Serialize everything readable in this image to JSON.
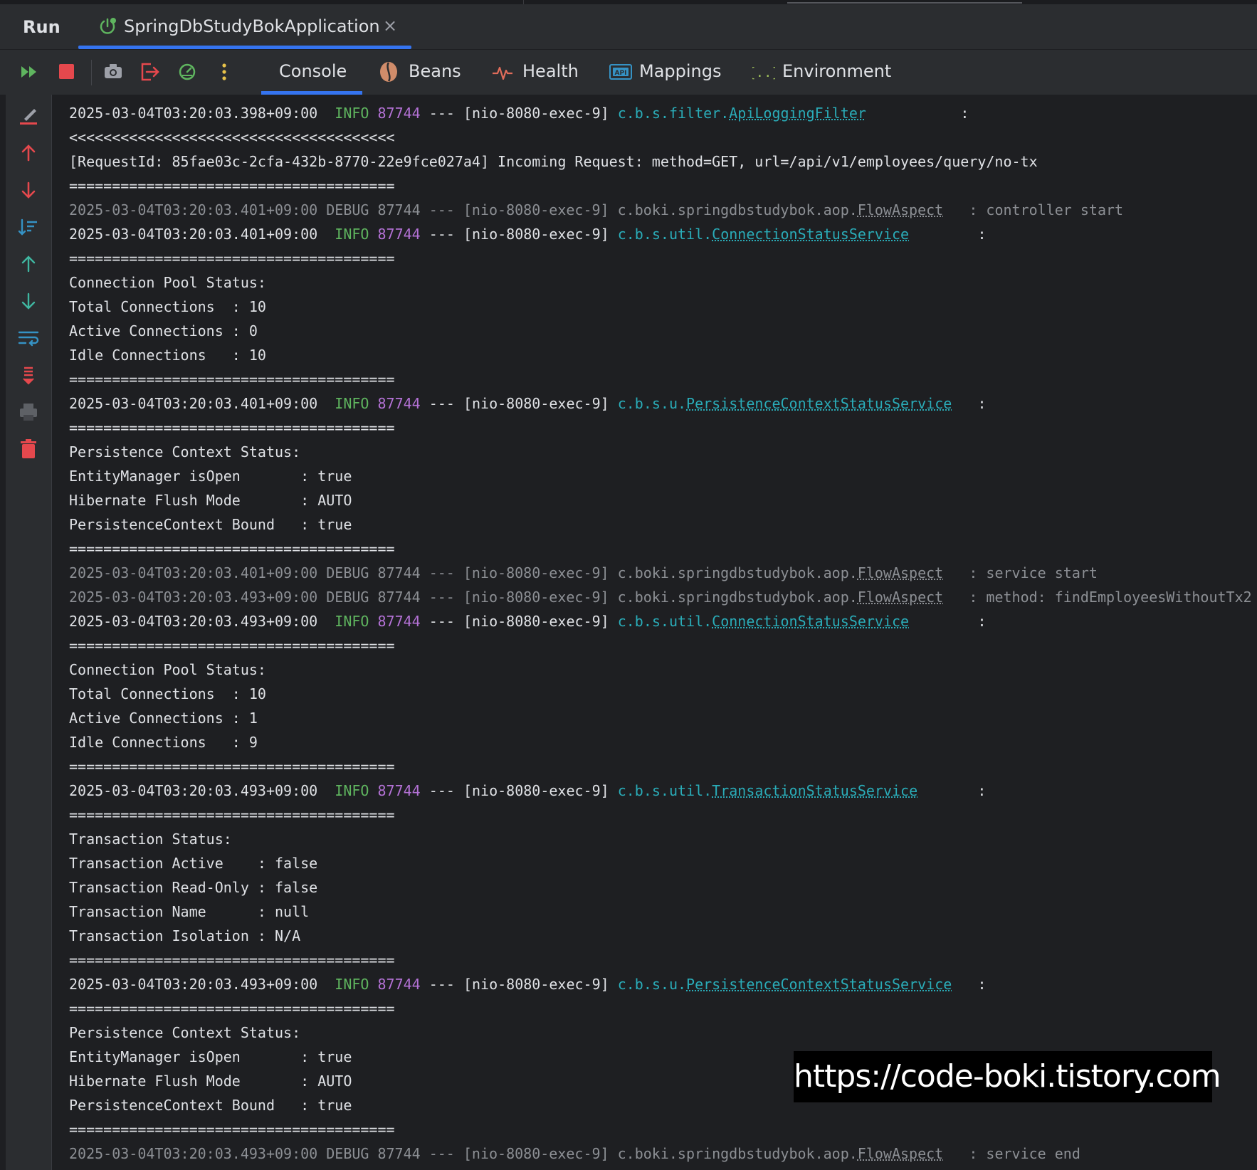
{
  "run_panel": {
    "title": "Run",
    "tab": {
      "label": "SpringDbStudyBokApplication",
      "close": "×"
    }
  },
  "toolbar": {
    "tabs": [
      {
        "label": "Console",
        "icon": "console"
      },
      {
        "label": "Beans",
        "icon": "beans-icon"
      },
      {
        "label": "Health",
        "icon": "health-icon"
      },
      {
        "label": "Mappings",
        "icon": "api-mappings-icon"
      },
      {
        "label": "Environment",
        "icon": "environment-icon"
      }
    ],
    "api_badge": "API",
    "env_badge": "{..}"
  },
  "colors": {
    "accent": "#3574f0",
    "info": "#5fb55f",
    "pid": "#b472d6",
    "logger": "#2aacb8",
    "stop": "#e5484d"
  },
  "console": {
    "lines": [
      {
        "type": "info",
        "ts": "2025-03-04T03:20:03.398+09:00",
        "level": "INFO",
        "pid": "87744",
        "sep": " --- ",
        "thread": "[nio-8080-exec-9] ",
        "pkg": "c.b.s.filter.",
        "cls": "ApiLoggingFilter",
        "pad": "          ",
        "tail": " :"
      },
      {
        "type": "text",
        "text": "<<<<<<<<<<<<<<<<<<<<<<<<<<<<<<<<<<<<<<"
      },
      {
        "type": "text",
        "text": "[RequestId: 85fae03c-2cfa-432b-8770-22e9fce027a4] Incoming Request: method=GET, url=/api/v1/employees/query/no-tx"
      },
      {
        "type": "text",
        "text": "======================================"
      },
      {
        "type": "debug",
        "text": "2025-03-04T03:20:03.401+09:00 DEBUG 87744 --- [nio-8080-exec-9] c.boki.springdbstudybok.aop.",
        "cls": "FlowAspect",
        "tail": "   : controller start"
      },
      {
        "type": "info",
        "ts": "2025-03-04T03:20:03.401+09:00",
        "level": "INFO",
        "pid": "87744",
        "sep": " --- ",
        "thread": "[nio-8080-exec-9] ",
        "pkg": "c.b.s.util.",
        "cls": "ConnectionStatusService",
        "pad": "       ",
        "tail": " :"
      },
      {
        "type": "text",
        "text": "======================================"
      },
      {
        "type": "text",
        "text": "Connection Pool Status:"
      },
      {
        "type": "text",
        "text": "Total Connections  : 10"
      },
      {
        "type": "text",
        "text": "Active Connections : 0"
      },
      {
        "type": "text",
        "text": "Idle Connections   : 10"
      },
      {
        "type": "text",
        "text": "======================================"
      },
      {
        "type": "info",
        "ts": "2025-03-04T03:20:03.401+09:00",
        "level": "INFO",
        "pid": "87744",
        "sep": " --- ",
        "thread": "[nio-8080-exec-9] ",
        "pkg": "c.b.s.u.",
        "cls": "PersistenceContextStatusService",
        "pad": "  ",
        "tail": " :"
      },
      {
        "type": "text",
        "text": "======================================"
      },
      {
        "type": "text",
        "text": "Persistence Context Status:"
      },
      {
        "type": "text",
        "text": "EntityManager isOpen       : true"
      },
      {
        "type": "text",
        "text": "Hibernate Flush Mode       : AUTO"
      },
      {
        "type": "text",
        "text": "PersistenceContext Bound   : true"
      },
      {
        "type": "text",
        "text": "======================================"
      },
      {
        "type": "debug",
        "text": "2025-03-04T03:20:03.401+09:00 DEBUG 87744 --- [nio-8080-exec-9] c.boki.springdbstudybok.aop.",
        "cls": "FlowAspect",
        "tail": "   : service start"
      },
      {
        "type": "debug",
        "text": "2025-03-04T03:20:03.493+09:00 DEBUG 87744 --- [nio-8080-exec-9] c.boki.springdbstudybok.aop.",
        "cls": "FlowAspect",
        "tail": "   : method: findEmployeesWithoutTx2"
      },
      {
        "type": "info",
        "ts": "2025-03-04T03:20:03.493+09:00",
        "level": "INFO",
        "pid": "87744",
        "sep": " --- ",
        "thread": "[nio-8080-exec-9] ",
        "pkg": "c.b.s.util.",
        "cls": "ConnectionStatusService",
        "pad": "       ",
        "tail": " :"
      },
      {
        "type": "text",
        "text": "======================================"
      },
      {
        "type": "text",
        "text": "Connection Pool Status:"
      },
      {
        "type": "text",
        "text": "Total Connections  : 10"
      },
      {
        "type": "text",
        "text": "Active Connections : 1"
      },
      {
        "type": "text",
        "text": "Idle Connections   : 9"
      },
      {
        "type": "text",
        "text": "======================================"
      },
      {
        "type": "info",
        "ts": "2025-03-04T03:20:03.493+09:00",
        "level": "INFO",
        "pid": "87744",
        "sep": " --- ",
        "thread": "[nio-8080-exec-9] ",
        "pkg": "c.b.s.util.",
        "cls": "TransactionStatusService",
        "pad": "      ",
        "tail": " :"
      },
      {
        "type": "text",
        "text": "======================================"
      },
      {
        "type": "text",
        "text": "Transaction Status:"
      },
      {
        "type": "text",
        "text": "Transaction Active    : false"
      },
      {
        "type": "text",
        "text": "Transaction Read-Only : false"
      },
      {
        "type": "text",
        "text": "Transaction Name      : null"
      },
      {
        "type": "text",
        "text": "Transaction Isolation : N/A"
      },
      {
        "type": "text",
        "text": "======================================"
      },
      {
        "type": "info",
        "ts": "2025-03-04T03:20:03.493+09:00",
        "level": "INFO",
        "pid": "87744",
        "sep": " --- ",
        "thread": "[nio-8080-exec-9] ",
        "pkg": "c.b.s.u.",
        "cls": "PersistenceContextStatusService",
        "pad": "  ",
        "tail": " :"
      },
      {
        "type": "text",
        "text": "======================================"
      },
      {
        "type": "text",
        "text": "Persistence Context Status:"
      },
      {
        "type": "text",
        "text": "EntityManager isOpen       : true"
      },
      {
        "type": "text",
        "text": "Hibernate Flush Mode       : AUTO"
      },
      {
        "type": "text",
        "text": "PersistenceContext Bound   : true"
      },
      {
        "type": "text",
        "text": "======================================"
      },
      {
        "type": "debug",
        "text": "2025-03-04T03:20:03.493+09:00 DEBUG 87744 --- [nio-8080-exec-9] c.boki.springdbstudybok.aop.",
        "cls": "FlowAspect",
        "tail": "   : service end"
      }
    ]
  },
  "watermark": "https://code-boki.tistory.com"
}
